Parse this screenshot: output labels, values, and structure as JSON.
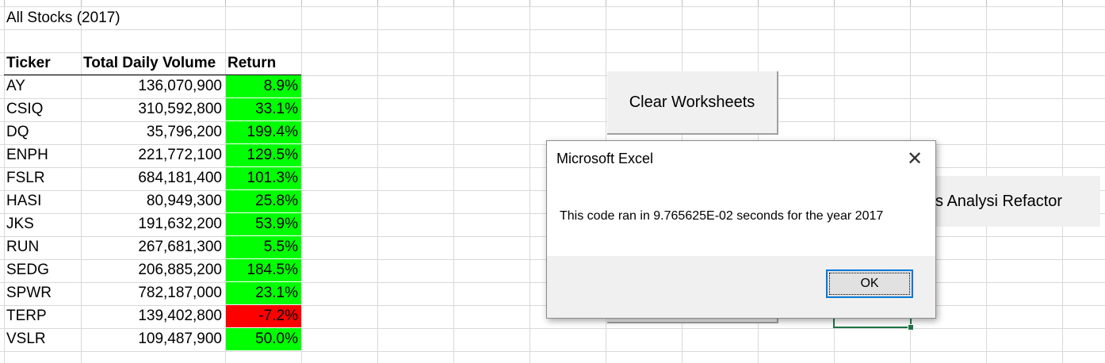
{
  "sheet": {
    "title": "All Stocks (2017)",
    "headers": {
      "ticker": "Ticker",
      "volume": "Total Daily Volume",
      "return": "Return"
    },
    "rows": [
      {
        "ticker": "AY",
        "volume": "136,070,900",
        "return": "8.9%",
        "status": "positive"
      },
      {
        "ticker": "CSIQ",
        "volume": "310,592,800",
        "return": "33.1%",
        "status": "positive"
      },
      {
        "ticker": "DQ",
        "volume": "35,796,200",
        "return": "199.4%",
        "status": "positive"
      },
      {
        "ticker": "ENPH",
        "volume": "221,772,100",
        "return": "129.5%",
        "status": "positive"
      },
      {
        "ticker": "FSLR",
        "volume": "684,181,400",
        "return": "101.3%",
        "status": "positive"
      },
      {
        "ticker": "HASI",
        "volume": "80,949,300",
        "return": "25.8%",
        "status": "positive"
      },
      {
        "ticker": "JKS",
        "volume": "191,632,200",
        "return": "53.9%",
        "status": "positive"
      },
      {
        "ticker": "RUN",
        "volume": "267,681,300",
        "return": "5.5%",
        "status": "positive"
      },
      {
        "ticker": "SEDG",
        "volume": "206,885,200",
        "return": "184.5%",
        "status": "positive"
      },
      {
        "ticker": "SPWR",
        "volume": "782,187,000",
        "return": "23.1%",
        "status": "positive"
      },
      {
        "ticker": "TERP",
        "volume": "139,402,800",
        "return": "-7.2%",
        "status": "negative"
      },
      {
        "ticker": "VSLR",
        "volume": "109,487,900",
        "return": "50.0%",
        "status": "positive"
      }
    ]
  },
  "colors": {
    "positive": "#00ff00",
    "negative": "#ff0000",
    "grid": "#d9d9d9",
    "selection": "#217346",
    "ok_border": "#0078d7"
  },
  "buttons": {
    "clear": "Clear Worksheets",
    "refactor": "ks Analysi Refactor"
  },
  "dialog": {
    "title": "Microsoft Excel",
    "message": "This code ran in 9.765625E-02 seconds for the year 2017",
    "ok": "OK",
    "close_icon": "close-icon"
  }
}
